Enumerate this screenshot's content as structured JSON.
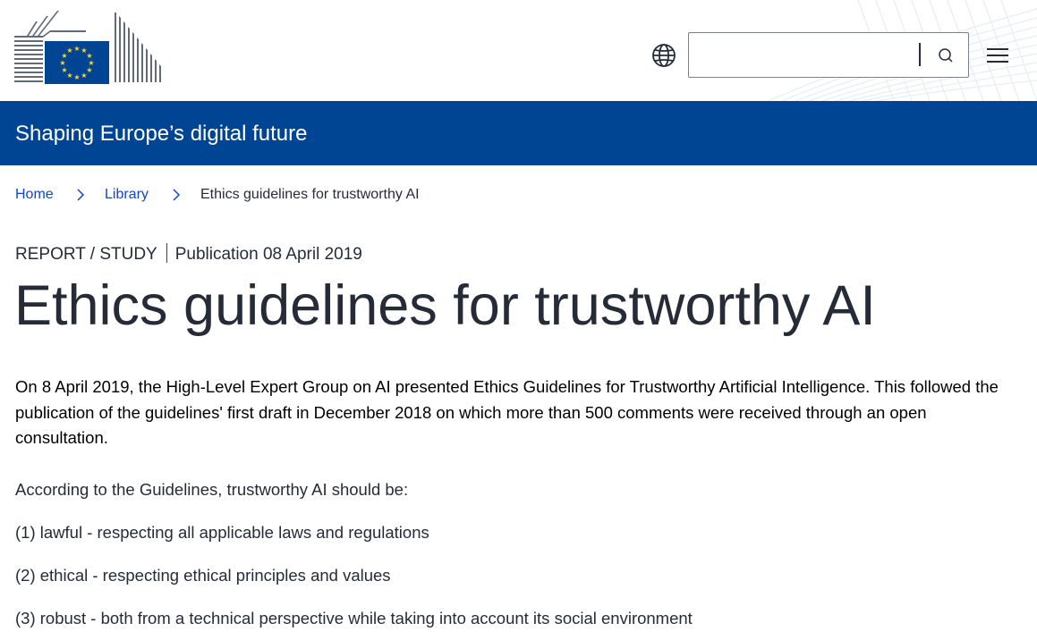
{
  "colors": {
    "brand_blue": "#004494",
    "eu_flag_blue": "#004494",
    "eu_star_yellow": "#ffd617",
    "link_blue": "#0e47cb",
    "text": "#262b38"
  },
  "header": {
    "logo_icon": "european-commission-logo",
    "language_icon": "globe-icon",
    "search": {
      "value": "",
      "placeholder": "",
      "icon": "search-icon"
    },
    "menu_icon": "hamburger-menu-icon"
  },
  "site_bar": {
    "name": "Shaping Europe’s digital future"
  },
  "breadcrumb": {
    "items": [
      {
        "label": "Home"
      },
      {
        "label": "Library"
      },
      {
        "label": "Ethics guidelines for trustworthy AI"
      }
    ],
    "separator_icon": "chevron-right-icon"
  },
  "meta": {
    "type": "REPORT / STUDY",
    "publication": "Publication 08 April 2019"
  },
  "page": {
    "title": "Ethics guidelines for trustworthy AI",
    "intro": "On 8 April 2019, the High-Level Expert Group on AI presented Ethics Guidelines for Trustworthy Artificial Intelligence. This followed the publication of the guidelines' first draft in December 2018 on which more than 500 comments were received through an open consultation.",
    "paragraphs": [
      "According to the Guidelines, trustworthy AI should be:",
      "(1) lawful -  respecting all applicable laws and regulations",
      "(2) ethical - respecting ethical principles and values",
      "(3) robust - both from a technical perspective while taking into account its social environment"
    ]
  }
}
